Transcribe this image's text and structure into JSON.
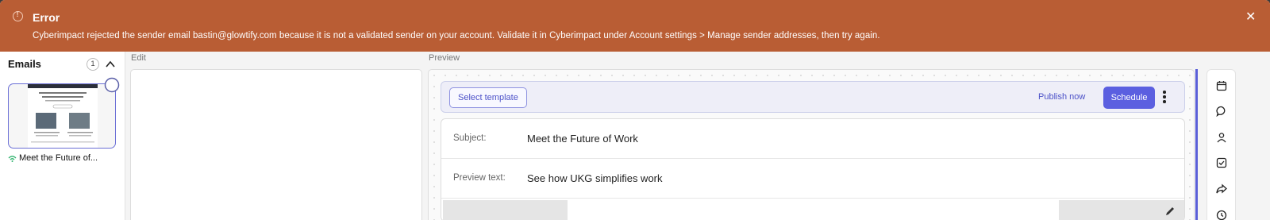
{
  "banner": {
    "title": "Error",
    "message": "Cyberimpact rejected the sender email bastin@glowtify.com because it is not a validated sender on your account. Validate it in Cyberimpact under Account settings > Manage sender addresses, then try again.",
    "close_glyph": "✕",
    "color": "#b95d34"
  },
  "emails": {
    "heading": "Emails",
    "count": "1",
    "items": [
      {
        "label": "Meet the Future of..."
      }
    ]
  },
  "edit": {
    "label": "Edit"
  },
  "preview": {
    "label": "Preview",
    "select_template": "Select template",
    "publish_now": "Publish now",
    "schedule": "Schedule",
    "subject_label": "Subject:",
    "subject_value": "Meet the Future of Work",
    "preview_text_label": "Preview text:",
    "preview_text_value": "See how UKG simplifies work"
  },
  "rail": {
    "icons": [
      "calendar-icon",
      "chat-icon",
      "user-icon",
      "checkbox-icon",
      "share-icon",
      "clock-icon"
    ]
  },
  "colors": {
    "accent": "#5b5fe0"
  }
}
